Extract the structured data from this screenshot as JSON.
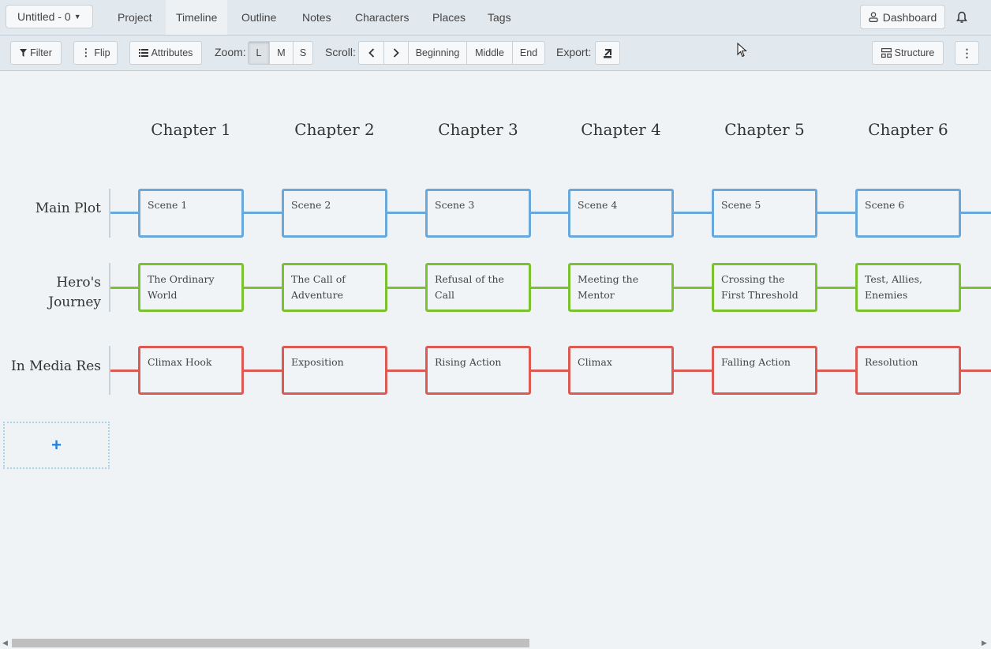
{
  "project": {
    "title": "Untitled - 0"
  },
  "nav": {
    "tabs": [
      {
        "label": "Project"
      },
      {
        "label": "Timeline",
        "active": true
      },
      {
        "label": "Outline"
      },
      {
        "label": "Notes"
      },
      {
        "label": "Characters"
      },
      {
        "label": "Places"
      },
      {
        "label": "Tags"
      }
    ],
    "dashboard_label": "Dashboard"
  },
  "toolbar": {
    "filter_label": "Filter",
    "flip_label": "Flip",
    "attributes_label": "Attributes",
    "zoom_label": "Zoom:",
    "zoom_options": [
      "L",
      "M",
      "S"
    ],
    "zoom_selected": "L",
    "scroll_label": "Scroll:",
    "scroll_prev": "<",
    "scroll_next": ">",
    "scroll_beginning": "Beginning",
    "scroll_middle": "Middle",
    "scroll_end": "End",
    "export_label": "Export:",
    "structure_label": "Structure"
  },
  "timeline": {
    "chapters": [
      "Chapter 1",
      "Chapter 2",
      "Chapter 3",
      "Chapter 4",
      "Chapter 5",
      "Chapter 6"
    ],
    "lines": [
      {
        "label": "Main Plot",
        "color": "#6aa8dc",
        "cards": [
          "Scene 1",
          "Scene 2",
          "Scene 3",
          "Scene 4",
          "Scene 5",
          "Scene 6"
        ]
      },
      {
        "label": "Hero's Journey",
        "color": "#7cc12f",
        "cards": [
          "The Ordinary World",
          "The Call of Adventure",
          "Refusal of the Call",
          "Meeting the Mentor",
          "Crossing the First Threshold",
          "Test, Allies, Enemies"
        ]
      },
      {
        "label": "In Media Res",
        "color": "#dc5a54",
        "cards": [
          "Climax Hook",
          "Exposition",
          "Rising Action",
          "Climax",
          "Falling Action",
          "Resolution"
        ]
      }
    ],
    "add_line_label": "+"
  }
}
